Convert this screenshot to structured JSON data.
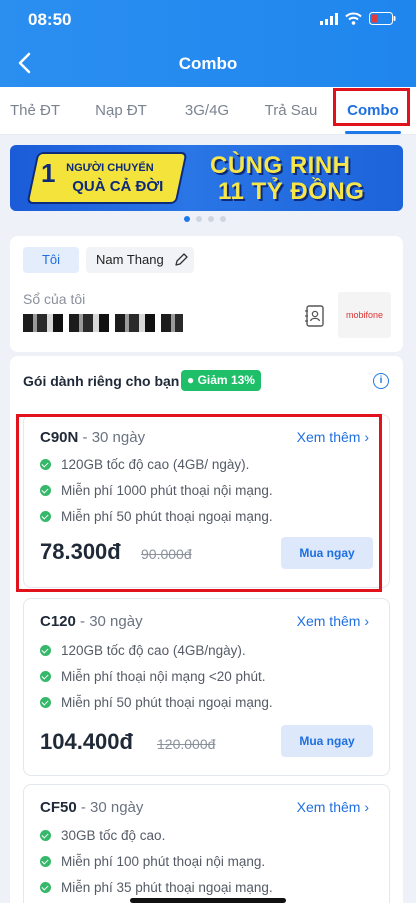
{
  "status": {
    "time": "08:50"
  },
  "header": {
    "title": "Combo"
  },
  "tabs": [
    {
      "label": "Thẻ ĐT"
    },
    {
      "label": "Nạp ĐT"
    },
    {
      "label": "3G/4G"
    },
    {
      "label": "Trả Sau"
    },
    {
      "label": "Combo"
    }
  ],
  "banner": {
    "left_line1": "NGƯỜI CHUYỂN",
    "left_num": "1",
    "left_line2": "QUÀ CẢ ĐỜI",
    "right_line1": "CÙNG RINH",
    "right_line2": "11 TỶ ĐỒNG"
  },
  "account": {
    "chip_selected": "Tôi",
    "chip_other": "Nam Thang",
    "label": "Sổ của tôi",
    "brand": "mobifone"
  },
  "section": {
    "title": "Gói dành riêng cho bạn",
    "discount": "Giảm 13%",
    "info": "i"
  },
  "packages": [
    {
      "name": "C90N",
      "duration": " - 30 ngày",
      "more": "Xem thêm",
      "features": [
        "120GB tốc độ cao (4GB/ ngày).",
        "Miễn phí 1000 phút thoại nội mạng.",
        "Miễn phí 50 phút thoại ngoại mạng."
      ],
      "price": "78.300đ",
      "old_price": "90.000đ",
      "buy": "Mua ngay"
    },
    {
      "name": "C120",
      "duration": " - 30 ngày",
      "more": "Xem thêm",
      "features": [
        "120GB tốc độ cao (4GB/ngày).",
        "Miễn phí thoại nội mạng <20 phút.",
        "Miễn phí 50 phút thoại ngoại mạng."
      ],
      "price": "104.400đ",
      "old_price": "120.000đ",
      "buy": "Mua ngay"
    },
    {
      "name": "CF50",
      "duration": " - 30 ngày",
      "more": "Xem thêm",
      "features": [
        "30GB tốc độ cao.",
        "Miễn phí 100 phút thoại nội mạng.",
        "Miễn phí 35 phút thoại ngoại mạng."
      ]
    }
  ],
  "colors": {
    "primary": "#1f78ea",
    "highlight": "#e0121b",
    "check": "#35b869"
  }
}
